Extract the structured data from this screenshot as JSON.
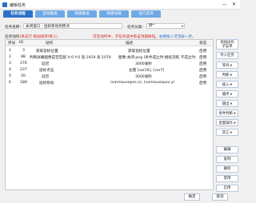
{
  "window": {
    "title": "编辑任务",
    "min_label": "—",
    "close_label": "✕"
  },
  "tabs": [
    "任务流程",
    "自动触发",
    "快捷触发",
    "快捷加载",
    "运行选项"
  ],
  "form": {
    "task_name_label": "任务名称：",
    "task_name_value": "关闭窗口 - 鼠标移动到原点",
    "group_label": "任务分类：",
    "group_value": "默*"
  },
  "action_list": {
    "label": "任务动作",
    "hint": "(单击行 拖动排序/移入)",
    "warning": "可在动作中，子任务选中单击顶部按钮。",
    "warning_extra": "右侧拖入可顶层一步。"
  },
  "table": {
    "headers": [
      "序号",
      "ID",
      "动作",
      "描述",
      "状态"
    ],
    "rows": [
      [
        "1",
        "3",
        "获取鼠标位置",
        "获取鼠标位置",
        "启用"
      ],
      [
        "2",
        "88",
        "判断屏幕图像是否匹配 X:0 Y:0 宽:1919 高:1079",
        "图像:关闭.png [条件成立时:继续流程 不成立时:中…",
        "启用"
      ],
      [
        "3",
        "276",
        "延迟",
        "3000毫秒",
        "启用"
      ],
      [
        "4",
        "237",
        "鼠标点击",
        "左键 [var26], [var7]",
        "启用"
      ],
      [
        "5",
        "20",
        "延迟",
        "3000毫秒",
        "启用"
      ],
      [
        "6",
        "188",
        "鼠标移动",
        "(varmousepos.x), (varmousepos.y)",
        "启用"
      ]
    ]
  },
  "side_buttons": {
    "add_action": "添加动作",
    "add_action_sub": "子菜单",
    "import": "导入任务",
    "wait": "等待",
    "judge": "判断",
    "insert": "插入",
    "loop": "循环",
    "jump": "跳出",
    "condition": "条件判断",
    "var": "变量操作",
    "other": "其它",
    "edit": "编辑",
    "copy": "复制",
    "delete": "删除",
    "disable": "禁用",
    "enable": "启用"
  },
  "footer": {
    "ok": "确定",
    "cancel": "取消"
  }
}
